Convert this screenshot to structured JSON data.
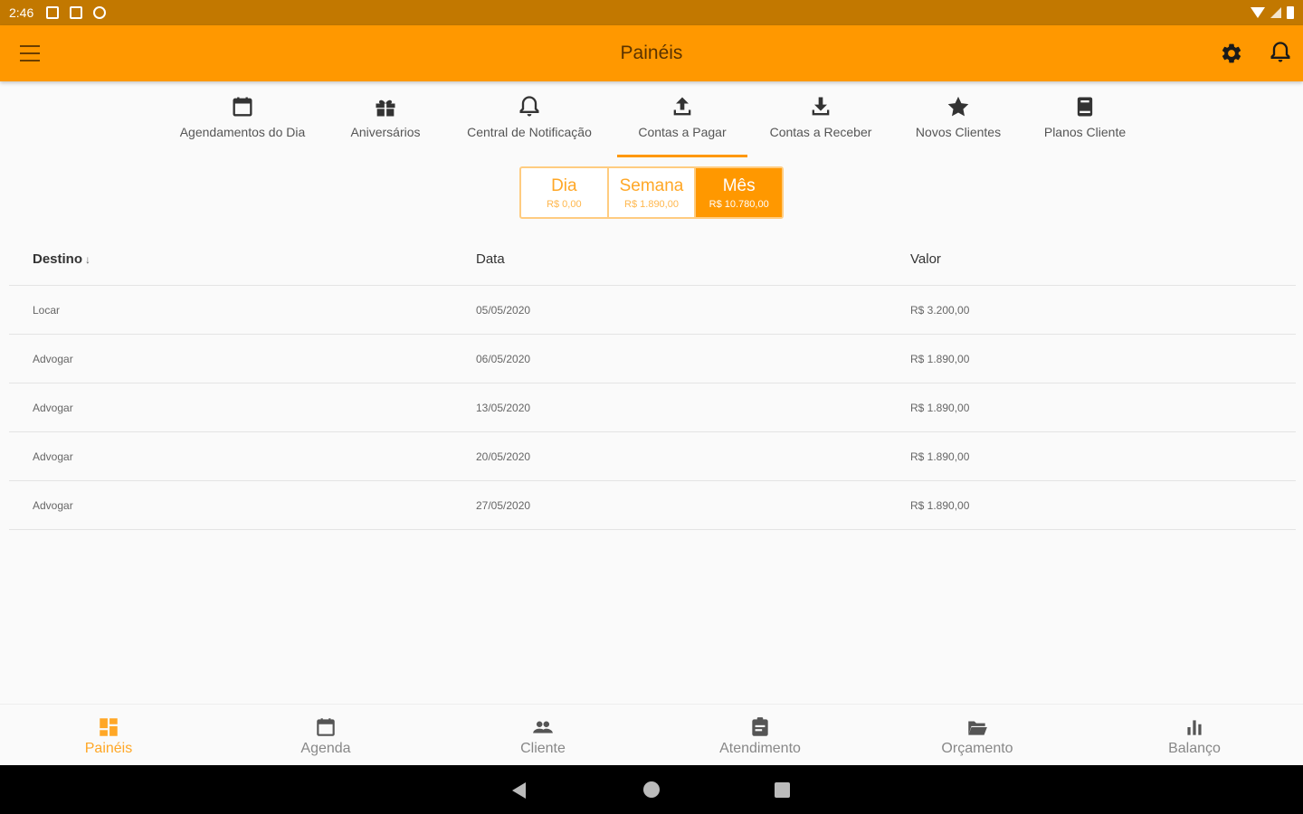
{
  "status_bar": {
    "time": "2:46"
  },
  "app_bar": {
    "title": "Painéis",
    "colors": {
      "primary": "#ff9800",
      "status": "#c27800"
    }
  },
  "tabs": [
    {
      "label": "Agendamentos do Dia",
      "icon": "calendar-icon"
    },
    {
      "label": "Aniversários",
      "icon": "gift-icon"
    },
    {
      "label": "Central de Notificação",
      "icon": "bell-icon"
    },
    {
      "label": "Contas a Pagar",
      "icon": "upload-icon",
      "active": true
    },
    {
      "label": "Contas a Receber",
      "icon": "download-icon"
    },
    {
      "label": "Novos Clientes",
      "icon": "star-icon"
    },
    {
      "label": "Planos Cliente",
      "icon": "book-icon"
    }
  ],
  "period": {
    "options": [
      {
        "label": "Dia",
        "value": "R$ 0,00"
      },
      {
        "label": "Semana",
        "value": "R$ 1.890,00"
      },
      {
        "label": "Mês",
        "value": "R$ 10.780,00",
        "selected": true
      }
    ]
  },
  "table": {
    "columns": [
      "Destino",
      "Data",
      "Valor"
    ],
    "sort_indicator": "↓",
    "rows": [
      {
        "destino": "Locar",
        "data": "05/05/2020",
        "valor": "R$ 3.200,00"
      },
      {
        "destino": "Advogar",
        "data": "06/05/2020",
        "valor": "R$ 1.890,00"
      },
      {
        "destino": "Advogar",
        "data": "13/05/2020",
        "valor": "R$ 1.890,00"
      },
      {
        "destino": "Advogar",
        "data": "20/05/2020",
        "valor": "R$ 1.890,00"
      },
      {
        "destino": "Advogar",
        "data": "27/05/2020",
        "valor": "R$ 1.890,00"
      }
    ]
  },
  "bottom_nav": [
    {
      "label": "Painéis",
      "icon": "dashboard-icon",
      "active": true
    },
    {
      "label": "Agenda",
      "icon": "calendar-icon"
    },
    {
      "label": "Cliente",
      "icon": "people-icon"
    },
    {
      "label": "Atendimento",
      "icon": "assignment-icon"
    },
    {
      "label": "Orçamento",
      "icon": "folder-open-icon"
    },
    {
      "label": "Balanço",
      "icon": "bar-chart-icon"
    }
  ]
}
